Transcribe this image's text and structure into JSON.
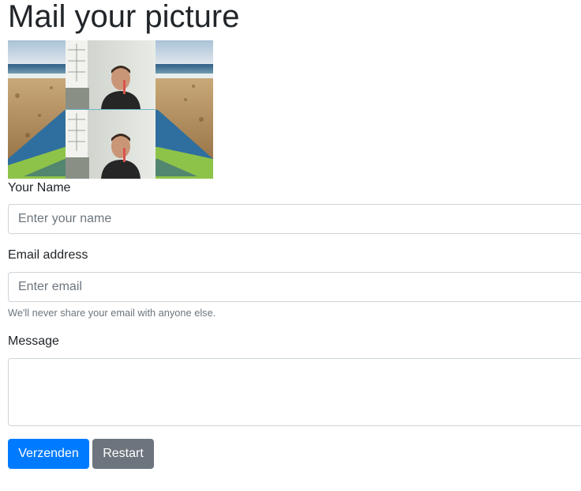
{
  "page": {
    "title": "Mail your picture"
  },
  "form": {
    "name_label": "Your Name",
    "name_placeholder": "Enter your name",
    "email_label": "Email address",
    "email_placeholder": "Enter email",
    "email_help": "We'll never share your email with anyone else.",
    "message_label": "Message",
    "message_value": "",
    "submit_label": "Verzenden",
    "restart_label": "Restart"
  },
  "colors": {
    "primary": "#007bff",
    "secondary": "#6c757d",
    "border": "#ced4da",
    "muted_text": "#6c757d"
  }
}
